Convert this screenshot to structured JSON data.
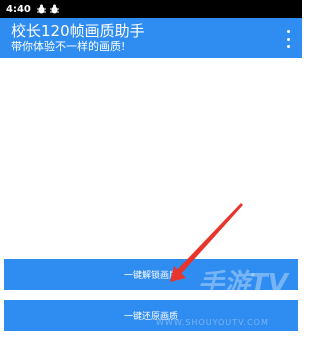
{
  "status_bar": {
    "time": "4:40",
    "notification_icons": [
      "bug-icon",
      "bug-icon"
    ]
  },
  "app_bar": {
    "title": "校长120帧画质助手",
    "subtitle": "带你体验不一样的画质!",
    "menu_icon": "more-vert-icon"
  },
  "actions": {
    "unlock_label": "一键解锁画质",
    "restore_label": "一键还原画质"
  },
  "watermark": {
    "brand": "手游TV",
    "url": "WWW.SHOUYOUTV.COM"
  },
  "colors": {
    "primary": "#2f8cf0",
    "status_bar": "#000000",
    "annotation_arrow": "#e8352b"
  }
}
